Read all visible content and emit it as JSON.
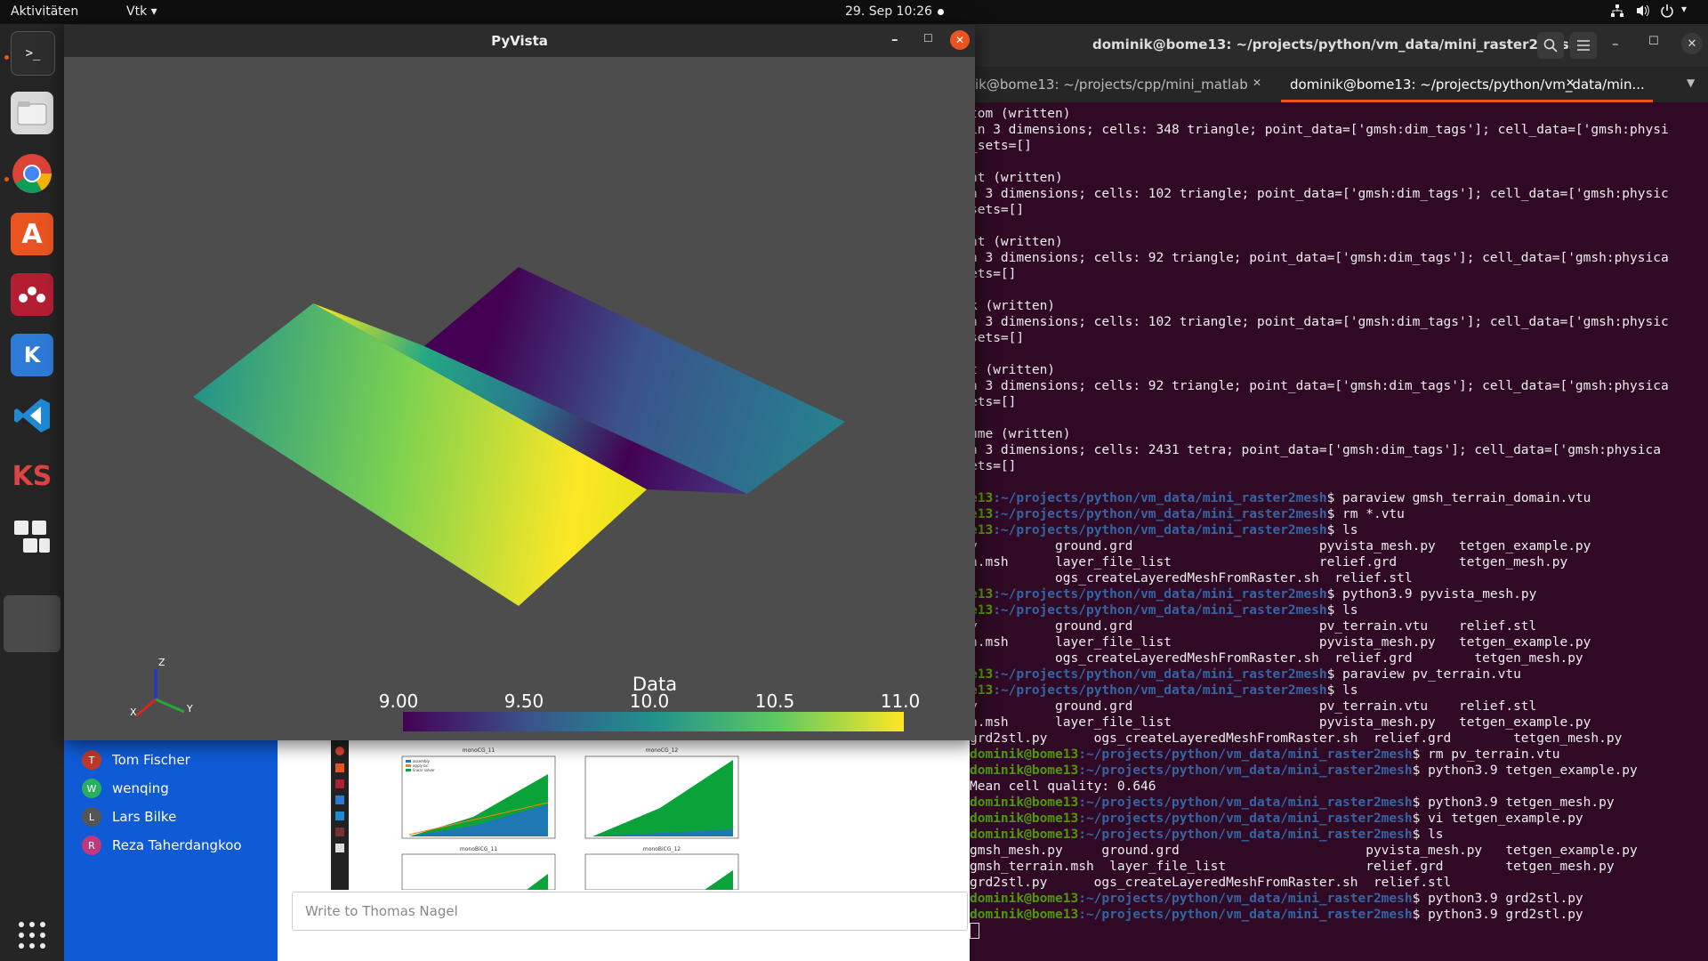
{
  "topbar": {
    "activities": "Aktivitäten",
    "app_menu": "Vtk ▾",
    "datetime": "29. Sep  10:26"
  },
  "pyvista": {
    "title": "PyVista",
    "colorbar": {
      "title": "Data",
      "ticks": [
        "9.00",
        "9.50",
        "10.0",
        "10.5",
        "11.0"
      ]
    },
    "axes": {
      "z": "Z",
      "x": "X",
      "y": "Y"
    }
  },
  "terminal": {
    "title": "dominik@bome13: ~/projects/python/vm_data/mini_raster2mesh",
    "tabs": [
      "ik@bome13: ~/projects/cpp/mini_matlab",
      "dominik@bome13: ~/projects/python/vm_data/min..."
    ],
    "prompt_user": "dominik@bome13",
    "prompt_host_short": "e13",
    "prompt_path": ":~/projects/python/vm_data/mini_raster2mesh",
    "lines": [
      {
        "type": "out",
        "text": "tom (written)"
      },
      {
        "type": "out",
        "text": "in 3 dimensions; cells: 348 triangle; point_data=['gmsh:dim_tags']; cell_data=['gmsh:physi"
      },
      {
        "type": "out",
        "text": "_sets=[]"
      },
      {
        "type": "out",
        "text": ""
      },
      {
        "type": "out",
        "text": "nt (written)"
      },
      {
        "type": "out",
        "text": "n 3 dimensions; cells: 102 triangle; point_data=['gmsh:dim_tags']; cell_data=['gmsh:physic"
      },
      {
        "type": "out",
        "text": "sets=[]"
      },
      {
        "type": "out",
        "text": ""
      },
      {
        "type": "out",
        "text": "ht (written)"
      },
      {
        "type": "out",
        "text": "n 3 dimensions; cells: 92 triangle; point_data=['gmsh:dim_tags']; cell_data=['gmsh:physica"
      },
      {
        "type": "out",
        "text": "ets=[]"
      },
      {
        "type": "out",
        "text": ""
      },
      {
        "type": "out",
        "text": "k (written)"
      },
      {
        "type": "out",
        "text": "n 3 dimensions; cells: 102 triangle; point_data=['gmsh:dim_tags']; cell_data=['gmsh:physic"
      },
      {
        "type": "out",
        "text": "sets=[]"
      },
      {
        "type": "out",
        "text": ""
      },
      {
        "type": "out",
        "text": "t (written)"
      },
      {
        "type": "out",
        "text": "n 3 dimensions; cells: 92 triangle; point_data=['gmsh:dim_tags']; cell_data=['gmsh:physica"
      },
      {
        "type": "out",
        "text": "ets=[]"
      },
      {
        "type": "out",
        "text": ""
      },
      {
        "type": "out",
        "text": "ume (written)"
      },
      {
        "type": "out",
        "text": "n 3 dimensions; cells: 2431 tetra; point_data=['gmsh:dim_tags']; cell_data=['gmsh:physica"
      },
      {
        "type": "out",
        "text": "ets=[]"
      },
      {
        "type": "out",
        "text": ""
      },
      {
        "type": "short",
        "cmd": "$ paraview gmsh_terrain_domain.vtu"
      },
      {
        "type": "short",
        "cmd": "$ rm *.vtu"
      },
      {
        "type": "short",
        "cmd": "$ ls"
      },
      {
        "type": "out",
        "text": "y          ground.grd                        pyvista_mesh.py   tetgen_example.py"
      },
      {
        "type": "out",
        "text": "n.msh      layer_file_list                   relief.grd        tetgen_mesh.py"
      },
      {
        "type": "out",
        "text": "           ogs_createLayeredMeshFromRaster.sh  relief.stl"
      },
      {
        "type": "short",
        "cmd": "$ python3.9 pyvista_mesh.py"
      },
      {
        "type": "short",
        "cmd": "$ ls"
      },
      {
        "type": "out",
        "text": "y          ground.grd                        pv_terrain.vtu    relief.stl"
      },
      {
        "type": "out",
        "text": "n.msh      layer_file_list                   pyvista_mesh.py   tetgen_example.py"
      },
      {
        "type": "out",
        "text": "           ogs_createLayeredMeshFromRaster.sh  relief.grd        tetgen_mesh.py"
      },
      {
        "type": "short",
        "cmd": "$ paraview pv_terrain.vtu"
      },
      {
        "type": "short",
        "cmd": "$ ls"
      },
      {
        "type": "out",
        "text": "y          ground.grd                        pv_terrain.vtu    relief.stl"
      },
      {
        "type": "out",
        "text": "n.msh      layer_file_list                   pyvista_mesh.py   tetgen_example.py"
      },
      {
        "type": "out",
        "text": "grd2stl.py      ogs_createLayeredMeshFromRaster.sh  relief.grd        tetgen_mesh.py"
      },
      {
        "type": "full",
        "cmd": "$ rm pv_terrain.vtu"
      },
      {
        "type": "full",
        "cmd": "$ python3.9 tetgen_example.py"
      },
      {
        "type": "out",
        "text": "Mean cell quality: 0.646"
      },
      {
        "type": "full",
        "cmd": "$ python3.9 tetgen_mesh.py"
      },
      {
        "type": "full",
        "cmd": "$ vi tetgen_example.py"
      },
      {
        "type": "full",
        "cmd": "$ ls"
      },
      {
        "type": "out",
        "text": "gmsh_mesh.py     ground.grd                        pyvista_mesh.py   tetgen_example.py"
      },
      {
        "type": "out",
        "text": "gmsh_terrain.msh  layer_file_list                  relief.grd        tetgen_mesh.py"
      },
      {
        "type": "out",
        "text": "grd2stl.py      ogs_createLayeredMeshFromRaster.sh  relief.stl"
      },
      {
        "type": "full",
        "cmd": "$ python3.9 grd2stl.py"
      },
      {
        "type": "full",
        "cmd": "$ python3.9 grd2stl.py"
      }
    ]
  },
  "chat": {
    "people": [
      {
        "name": "Tom Fischer",
        "initial": "T",
        "color": "#c0392b"
      },
      {
        "name": "wenqing",
        "initial": "W",
        "color": "#27ae60"
      },
      {
        "name": "Lars Bilke",
        "initial": "L",
        "color": "#555555"
      },
      {
        "name": "Reza Taherdangkoo",
        "initial": "R",
        "color": "#c0397b"
      }
    ],
    "placeholder": "Write to Thomas Nagel",
    "thumbs": [
      {
        "title": "monoCG_11"
      },
      {
        "title": "monoCG_12"
      },
      {
        "title": "monoBiCG_11"
      },
      {
        "title": "monoBiCG_12"
      }
    ],
    "legend": [
      "assembly",
      "apply bc",
      "linear solver"
    ]
  },
  "colors": {
    "terminal_bg": "#300a24",
    "prompt_green": "#4e9a06",
    "prompt_blue": "#3465a4",
    "accent": "#e95420",
    "chat_blue": "#0f5bd6"
  }
}
